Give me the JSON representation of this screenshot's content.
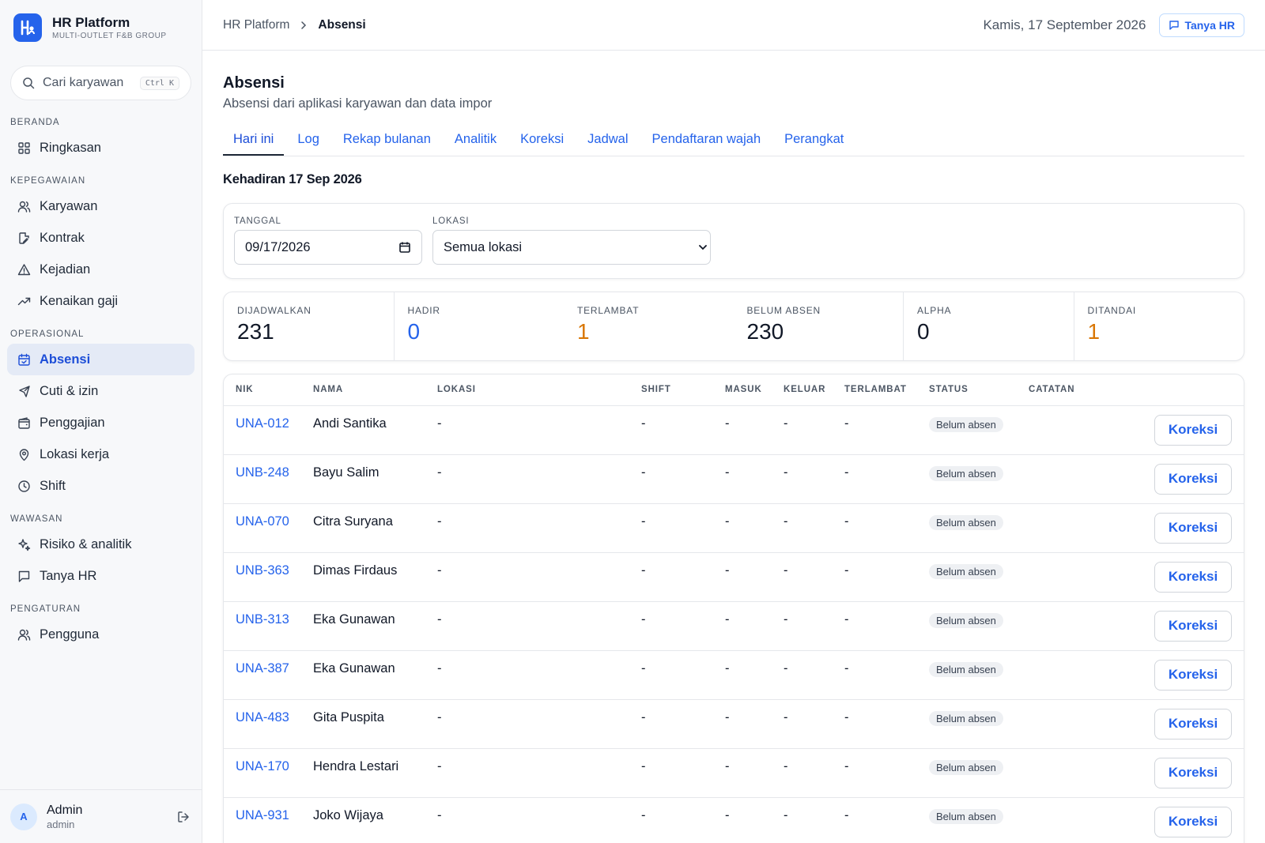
{
  "brand": {
    "name": "HR Platform",
    "sub": "MULTI-OUTLET F&B GROUP",
    "logo": "H"
  },
  "search": {
    "placeholder": "Cari karyawan",
    "shortcut": "Ctrl K"
  },
  "nav": {
    "sections": [
      {
        "label": "BERANDA",
        "items": [
          {
            "label": "Ringkasan",
            "icon": "grid-icon"
          }
        ]
      },
      {
        "label": "KEPEGAWAIAN",
        "items": [
          {
            "label": "Karyawan",
            "icon": "users-icon"
          },
          {
            "label": "Kontrak",
            "icon": "file-edit-icon"
          },
          {
            "label": "Kejadian",
            "icon": "warning-icon"
          },
          {
            "label": "Kenaikan gaji",
            "icon": "trending-up-icon"
          }
        ]
      },
      {
        "label": "OPERASIONAL",
        "items": [
          {
            "label": "Absensi",
            "icon": "calendar-check-icon",
            "active": true
          },
          {
            "label": "Cuti & izin",
            "icon": "plane-icon"
          },
          {
            "label": "Penggajian",
            "icon": "wallet-icon"
          },
          {
            "label": "Lokasi kerja",
            "icon": "map-pin-icon"
          },
          {
            "label": "Shift",
            "icon": "clock-icon"
          }
        ]
      },
      {
        "label": "WAWASAN",
        "items": [
          {
            "label": "Risiko & analitik",
            "icon": "sparkles-icon"
          },
          {
            "label": "Tanya HR",
            "icon": "chat-icon"
          }
        ]
      },
      {
        "label": "PENGATURAN",
        "items": [
          {
            "label": "Pengguna",
            "icon": "users-icon"
          }
        ]
      }
    ]
  },
  "user": {
    "initial": "A",
    "name": "Admin",
    "role": "admin"
  },
  "topbar": {
    "crumb_root": "HR Platform",
    "crumb_current": "Absensi",
    "date": "Kamis, 17 September 2026",
    "ask_label": "Tanya HR"
  },
  "page": {
    "title": "Absensi",
    "subtitle": "Absensi dari aplikasi karyawan dan data impor"
  },
  "tabs": [
    "Hari ini",
    "Log",
    "Rekap bulanan",
    "Analitik",
    "Koreksi",
    "Jadwal",
    "Pendaftaran wajah",
    "Perangkat"
  ],
  "section_heading": "Kehadiran 17 Sep 2026",
  "filters": {
    "date_label": "TANGGAL",
    "date_value": "09/17/2026",
    "location_label": "LOKASI",
    "location_value": "Semua lokasi"
  },
  "stats": [
    {
      "label": "DIJADWALKAN",
      "value": "231",
      "color": "default"
    },
    {
      "label": "HADIR",
      "value": "0",
      "color": "blue"
    },
    {
      "label": "TERLAMBAT",
      "value": "1",
      "color": "orange"
    },
    {
      "label": "BELUM ABSEN",
      "value": "230",
      "color": "default"
    },
    {
      "label": "ALPHA",
      "value": "0",
      "color": "default"
    },
    {
      "label": "DITANDAI",
      "value": "1",
      "color": "orange"
    }
  ],
  "table": {
    "headers": [
      "NIK",
      "NAMA",
      "LOKASI",
      "SHIFT",
      "MASUK",
      "KELUAR",
      "TERLAMBAT",
      "STATUS",
      "CATATAN"
    ],
    "action_label": "Koreksi",
    "rows": [
      {
        "nik": "UNA-012",
        "nama": "Andi Santika",
        "lokasi": "-",
        "shift": "-",
        "masuk": "-",
        "keluar": "-",
        "terlambat": "-",
        "status": "Belum absen"
      },
      {
        "nik": "UNB-248",
        "nama": "Bayu Salim",
        "lokasi": "-",
        "shift": "-",
        "masuk": "-",
        "keluar": "-",
        "terlambat": "-",
        "status": "Belum absen"
      },
      {
        "nik": "UNA-070",
        "nama": "Citra Suryana",
        "lokasi": "-",
        "shift": "-",
        "masuk": "-",
        "keluar": "-",
        "terlambat": "-",
        "status": "Belum absen"
      },
      {
        "nik": "UNB-363",
        "nama": "Dimas Firdaus",
        "lokasi": "-",
        "shift": "-",
        "masuk": "-",
        "keluar": "-",
        "terlambat": "-",
        "status": "Belum absen"
      },
      {
        "nik": "UNB-313",
        "nama": "Eka Gunawan",
        "lokasi": "-",
        "shift": "-",
        "masuk": "-",
        "keluar": "-",
        "terlambat": "-",
        "status": "Belum absen"
      },
      {
        "nik": "UNA-387",
        "nama": "Eka Gunawan",
        "lokasi": "-",
        "shift": "-",
        "masuk": "-",
        "keluar": "-",
        "terlambat": "-",
        "status": "Belum absen"
      },
      {
        "nik": "UNA-483",
        "nama": "Gita Puspita",
        "lokasi": "-",
        "shift": "-",
        "masuk": "-",
        "keluar": "-",
        "terlambat": "-",
        "status": "Belum absen"
      },
      {
        "nik": "UNA-170",
        "nama": "Hendra Lestari",
        "lokasi": "-",
        "shift": "-",
        "masuk": "-",
        "keluar": "-",
        "terlambat": "-",
        "status": "Belum absen"
      },
      {
        "nik": "UNA-931",
        "nama": "Joko Wijaya",
        "lokasi": "-",
        "shift": "-",
        "masuk": "-",
        "keluar": "-",
        "terlambat": "-",
        "status": "Belum absen"
      }
    ]
  },
  "colors": {
    "accent": "#2563eb",
    "warning": "#d97706",
    "active_bg": "#e4eaf6"
  }
}
